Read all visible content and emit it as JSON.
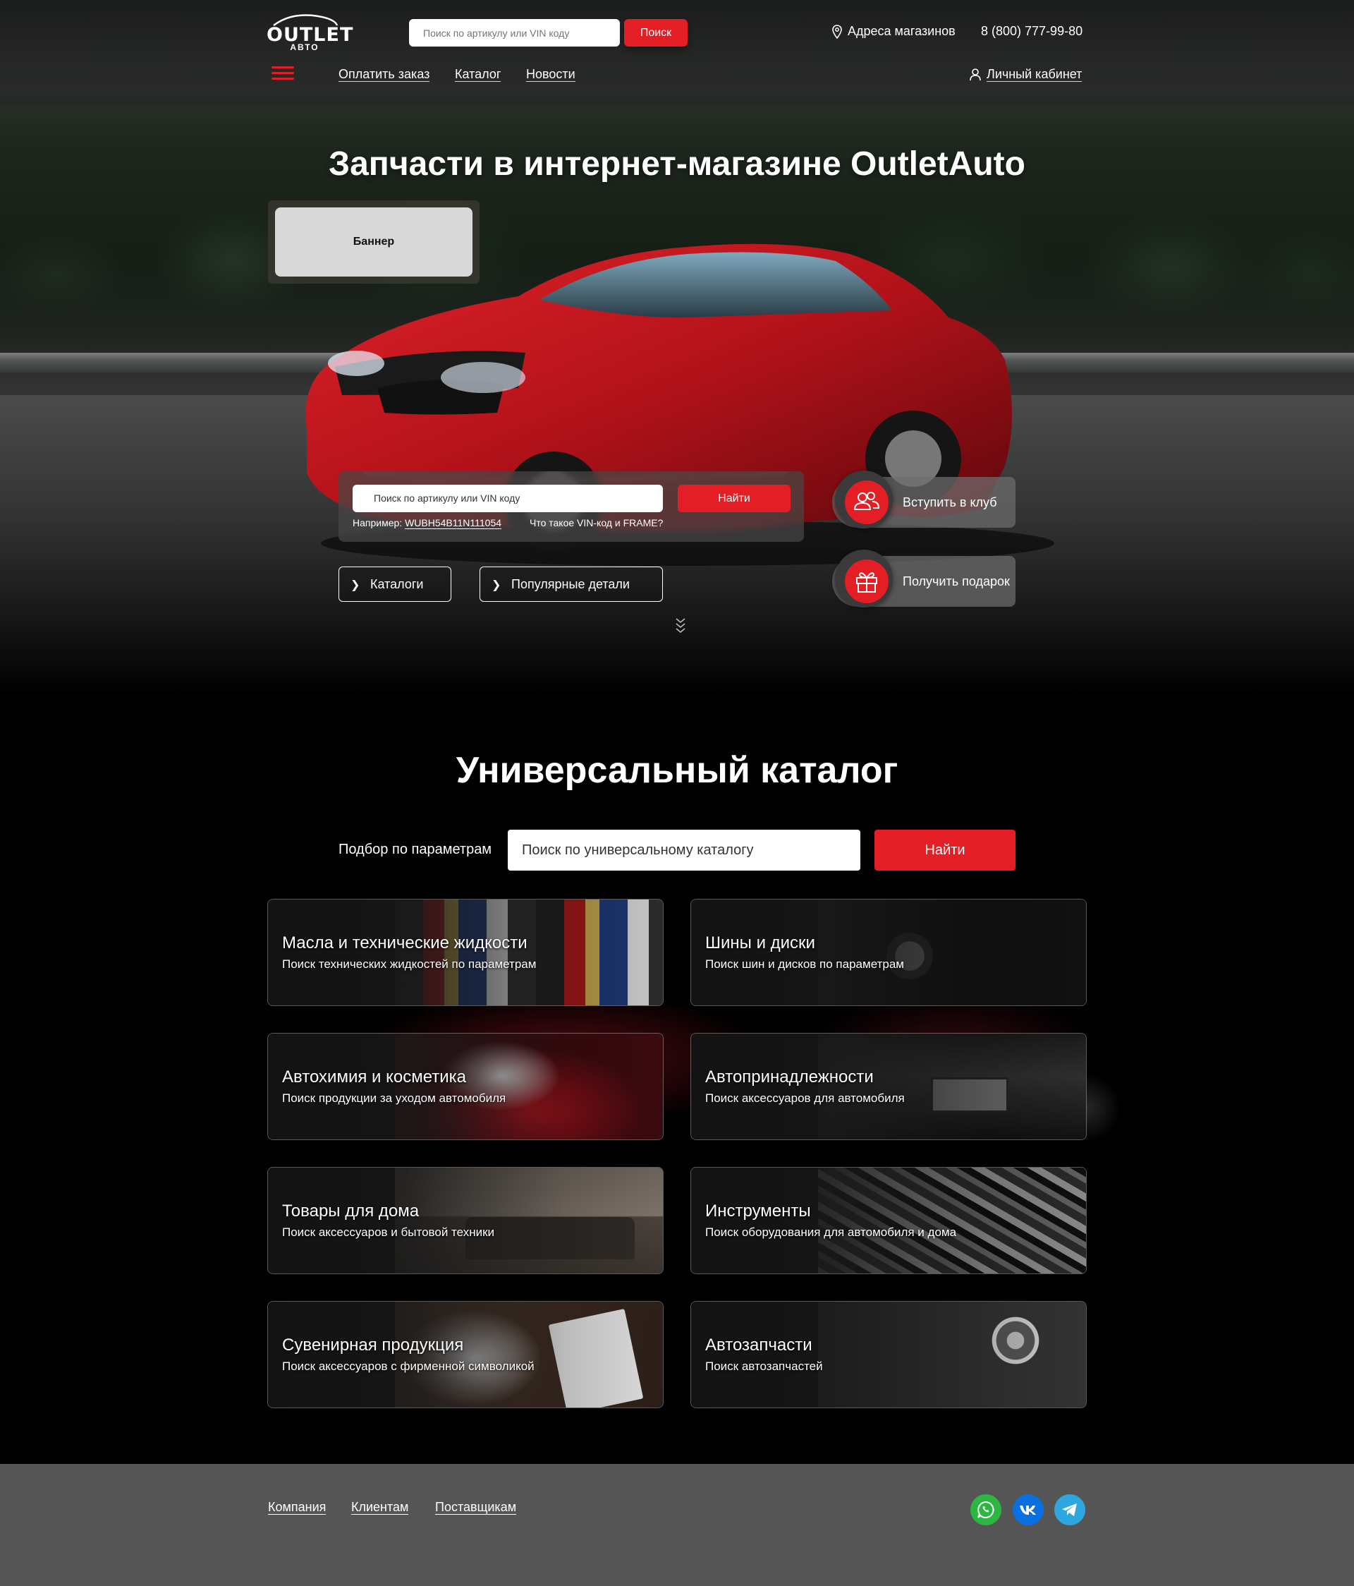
{
  "header": {
    "logo_text": "OUTLET",
    "logo_sub": "АВТО",
    "search_placeholder": "Поиск по артикулу или VIN коду",
    "search_button": "Поиск",
    "stores": "Адреса магазинов",
    "phone": "8 (800) 777-99-80"
  },
  "nav": {
    "items": [
      {
        "label": "Оплатить заказ"
      },
      {
        "label": "Каталог"
      },
      {
        "label": "Новости"
      }
    ],
    "cabinet": "Личный кабинет"
  },
  "hero": {
    "title": "Запчасти в интернет-магазине OutletAuto",
    "banner": "Баннер",
    "vin_placeholder": "Поиск по артикулу или VIN коду",
    "vin_button": "Найти",
    "example_label": "Например:",
    "example_value": "WUBH54B11N111054",
    "vin_help": "Что такое VIN-код и FRAME?",
    "buttons": {
      "catalogs": "Каталоги",
      "popular": "Популярные детали"
    },
    "club": "Вступить в клуб",
    "gift": "Получить подарок"
  },
  "catalog": {
    "title": "Универсальный каталог",
    "param_label": "Подбор по параметрам",
    "search_placeholder": "Поиск по универсальному каталогу",
    "button": "Найти",
    "cards": [
      {
        "title": "Масла и технические жидкости",
        "subtitle": "Поиск технических жидкостей по  параметрам"
      },
      {
        "title": "Шины и диски",
        "subtitle": "Поиск шин и дисков по  параметрам"
      },
      {
        "title": "Автохимия и косметика",
        "subtitle": "Поиск продукции за уходом автомобиля"
      },
      {
        "title": "Автопринадлежности",
        "subtitle": "Поиск аксессуаров для автомобиля"
      },
      {
        "title": "Товары для дома",
        "subtitle": "Поиск аксессуаров и бытовой техники"
      },
      {
        "title": "Инструменты",
        "subtitle": "Поиск оборудования для автомобиля и дома"
      },
      {
        "title": "Сувенирная продукция",
        "subtitle": "Поиск аксессуаров с  фирменной символикой"
      },
      {
        "title": "Автозапчасти",
        "subtitle": "Поиск автозапчастей"
      }
    ]
  },
  "footer": {
    "links": [
      {
        "label": "Компания"
      },
      {
        "label": "Клиентам"
      },
      {
        "label": "Поставщикам"
      }
    ],
    "socials": [
      {
        "icon": "whatsapp-icon",
        "color": "#2bb741"
      },
      {
        "icon": "vk-icon",
        "color": "#0a6fe0"
      },
      {
        "icon": "telegram-icon",
        "color": "#2ea6e0"
      }
    ]
  },
  "colors": {
    "accent": "#e31e24",
    "footer_bg": "#555555",
    "page_bg": "#000000"
  }
}
